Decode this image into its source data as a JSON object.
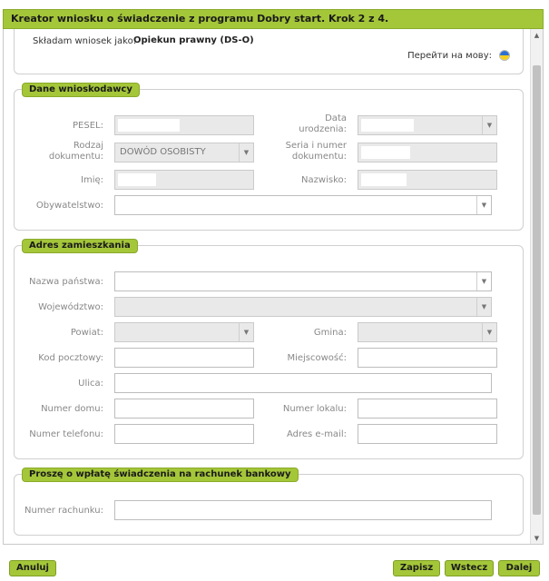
{
  "window": {
    "title": "Kreator wniosku o świadczenie z programu Dobry start. Krok 2 z 4."
  },
  "intro": {
    "submit_as_label": "Składam wniosek jako:",
    "submit_as_value": "Opiekun prawny (DS-O)",
    "language_link": "Перейти на мову:",
    "flag_icon": "ukraine-flag-icon",
    "flag_colors": [
      "#2d6fd0",
      "#f5cf1b"
    ]
  },
  "applicant": {
    "legend": "Dane wnioskodawcy",
    "pesel_label": "PESEL:",
    "birth_date_label": "Data urodzenia:",
    "doc_type_label": "Rodzaj dokumentu:",
    "doc_type_value": "DOWÓD OSOBISTY",
    "doc_number_label": "Seria i numer dokumentu:",
    "first_name_label": "Imię:",
    "last_name_label": "Nazwisko:",
    "citizenship_label": "Obywatelstwo:"
  },
  "address": {
    "legend": "Adres zamieszkania",
    "country_label": "Nazwa państwa:",
    "voivodeship_label": "Województwo:",
    "county_label": "Powiat:",
    "commune_label": "Gmina:",
    "postal_code_label": "Kod pocztowy:",
    "city_label": "Miejscowość:",
    "street_label": "Ulica:",
    "house_number_label": "Numer domu:",
    "flat_number_label": "Numer lokalu:",
    "phone_label": "Numer telefonu:",
    "email_label": "Adres e-mail:"
  },
  "bank": {
    "legend": "Proszę o wpłatę świadczenia na rachunek bankowy",
    "account_label": "Numer rachunku:"
  },
  "footer": {
    "cancel": "Anuluj",
    "save": "Zapisz",
    "back": "Wstecz",
    "next": "Dalej"
  },
  "theme": {
    "accent": "#a4c639",
    "accent_border": "#8aab2a"
  }
}
